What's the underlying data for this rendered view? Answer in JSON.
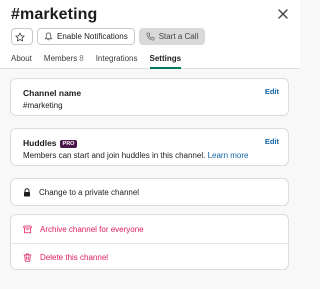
{
  "header": {
    "title": "#marketing",
    "buttons": {
      "notifications": "Enable Notifications",
      "call": "Start a Call"
    }
  },
  "tabs": [
    {
      "label": "About",
      "count": ""
    },
    {
      "label": "Members",
      "count": "8"
    },
    {
      "label": "Integrations",
      "count": ""
    },
    {
      "label": "Settings",
      "count": ""
    }
  ],
  "active_tab": "Settings",
  "channel_name": {
    "label": "Channel name",
    "value": "#marketing",
    "edit": "Edit"
  },
  "huddles": {
    "label": "Huddles",
    "badge": "PRO",
    "description": "Members can start and join huddles in this channel.",
    "learn_more": "Learn more",
    "edit": "Edit"
  },
  "private_channel": {
    "label": "Change to a private channel"
  },
  "danger": {
    "archive": "Archive channel for everyone",
    "delete": "Delete this channel"
  },
  "colors": {
    "accent": "#007a5a",
    "link": "#1264a3",
    "danger": "#e01e5a",
    "pro_badge": "#4a154b"
  },
  "icons": [
    "star-icon",
    "bell-icon",
    "phone-icon",
    "close-icon",
    "lock-icon",
    "archive-icon",
    "trash-icon"
  ]
}
